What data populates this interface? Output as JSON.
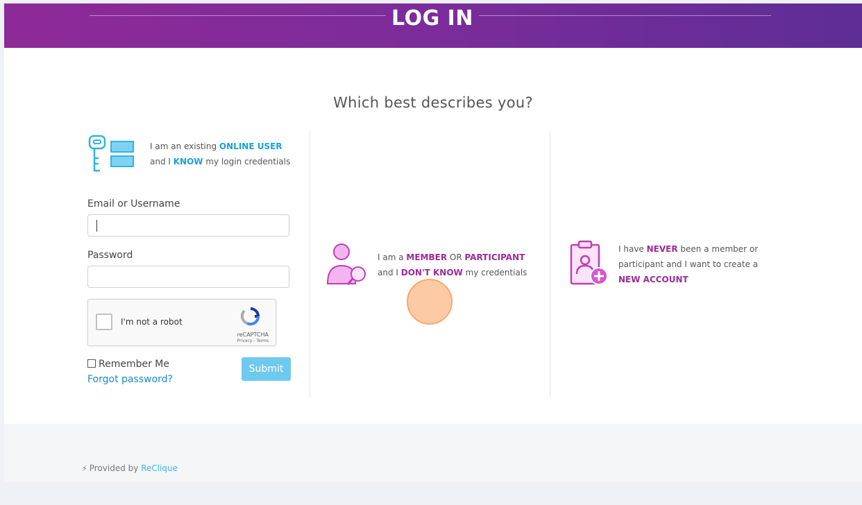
{
  "header": {
    "title": "LOG IN"
  },
  "question": "Which best describes you?",
  "option_online_user": {
    "line1_prefix": "I am an existing ",
    "line1_highlight": "ONLINE USER",
    "line2_prefix": "and I ",
    "line2_highlight": "KNOW",
    "line2_suffix": " my login credentials"
  },
  "login_form": {
    "email_label": "Email or Username",
    "email_value": "",
    "password_label": "Password",
    "password_value": "",
    "captcha_text": "I'm not a robot",
    "captcha_brand": "reCAPTCHA",
    "captcha_links": "Privacy - Terms",
    "remember_label": "Remember Me",
    "forgot_label": "Forgot password?",
    "submit_label": "Submit"
  },
  "option_member": {
    "line1_prefix": "I am a ",
    "line1_highlight1": "MEMBER",
    "line1_mid": " OR ",
    "line1_highlight2": "PARTICIPANT",
    "line2_prefix": "and I ",
    "line2_highlight": "DON'T KNOW",
    "line2_suffix": " my credentials"
  },
  "option_new": {
    "line1_prefix": "I have ",
    "line1_highlight": "NEVER",
    "line1_suffix": " been a member or",
    "line2": "participant and I want to create a",
    "line3_highlight": "NEW ACCOUNT"
  },
  "footer": {
    "provided_prefix": "Provided by ",
    "provided_link": "ReClique"
  },
  "colors": {
    "header_start": "#8e2a98",
    "header_end": "#5e2d96",
    "blue_accent": "#1aa0d8",
    "purple_accent": "#9c2a9c",
    "submit_bg": "#6dc9ee"
  }
}
